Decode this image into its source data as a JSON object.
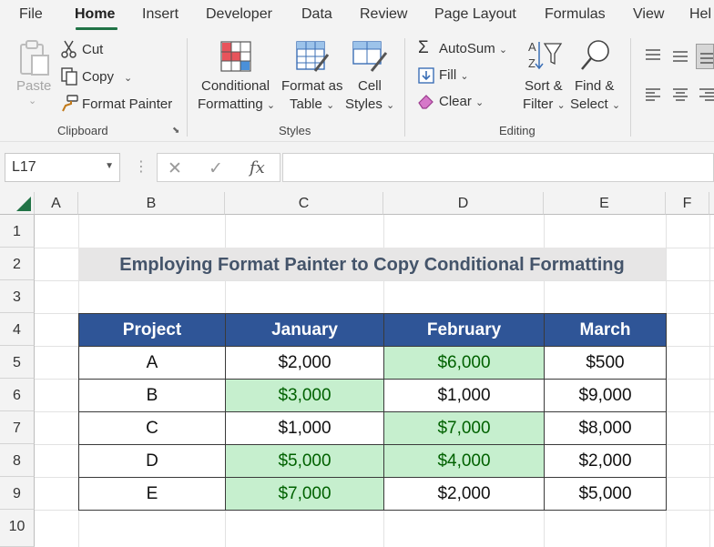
{
  "menu": {
    "tabs": [
      "File",
      "Home",
      "Insert",
      "Developer",
      "Data",
      "Review",
      "Page Layout",
      "Formulas",
      "View",
      "Hel"
    ],
    "active": "Home"
  },
  "ribbon": {
    "clipboard": {
      "paste": "Paste",
      "cut": "Cut",
      "copy": "Copy",
      "format_painter": "Format Painter",
      "label": "Clipboard"
    },
    "styles": {
      "conditional_formatting": [
        "Conditional",
        "Formatting"
      ],
      "format_as_table": [
        "Format as",
        "Table"
      ],
      "cell_styles": [
        "Cell",
        "Styles"
      ],
      "label": "Styles"
    },
    "editing": {
      "autosum": "AutoSum",
      "fill": "Fill",
      "clear": "Clear",
      "sort_filter": [
        "Sort &",
        "Filter"
      ],
      "find_select": [
        "Find &",
        "Select"
      ],
      "label": "Editing"
    }
  },
  "formula_bar": {
    "name_box": "L17",
    "fx": "fx",
    "formula": ""
  },
  "sheet": {
    "columns": [
      "A",
      "B",
      "C",
      "D",
      "E",
      "F"
    ],
    "rows": [
      "1",
      "2",
      "3",
      "4",
      "5",
      "6",
      "7",
      "8",
      "9",
      "10"
    ],
    "title": "Employing Format Painter to Copy Conditional Formatting",
    "table": {
      "headers": [
        "Project",
        "January",
        "February",
        "March"
      ],
      "rows": [
        [
          "A",
          "$2,000",
          "$6,000",
          "$500"
        ],
        [
          "B",
          "$3,000",
          "$1,000",
          "$9,000"
        ],
        [
          "C",
          "$1,000",
          "$7,000",
          "$8,000"
        ],
        [
          "D",
          "$5,000",
          "$4,000",
          "$2,000"
        ],
        [
          "E",
          "$7,000",
          "$2,000",
          "$5,000"
        ]
      ],
      "highlighted": [
        [
          false,
          false,
          true,
          false
        ],
        [
          false,
          true,
          false,
          false
        ],
        [
          false,
          false,
          true,
          false
        ],
        [
          false,
          true,
          true,
          false
        ],
        [
          false,
          true,
          false,
          false
        ]
      ],
      "highlight_fill": "#c6efce",
      "highlight_text": "#006100",
      "header_fill": "#2f5597"
    }
  }
}
